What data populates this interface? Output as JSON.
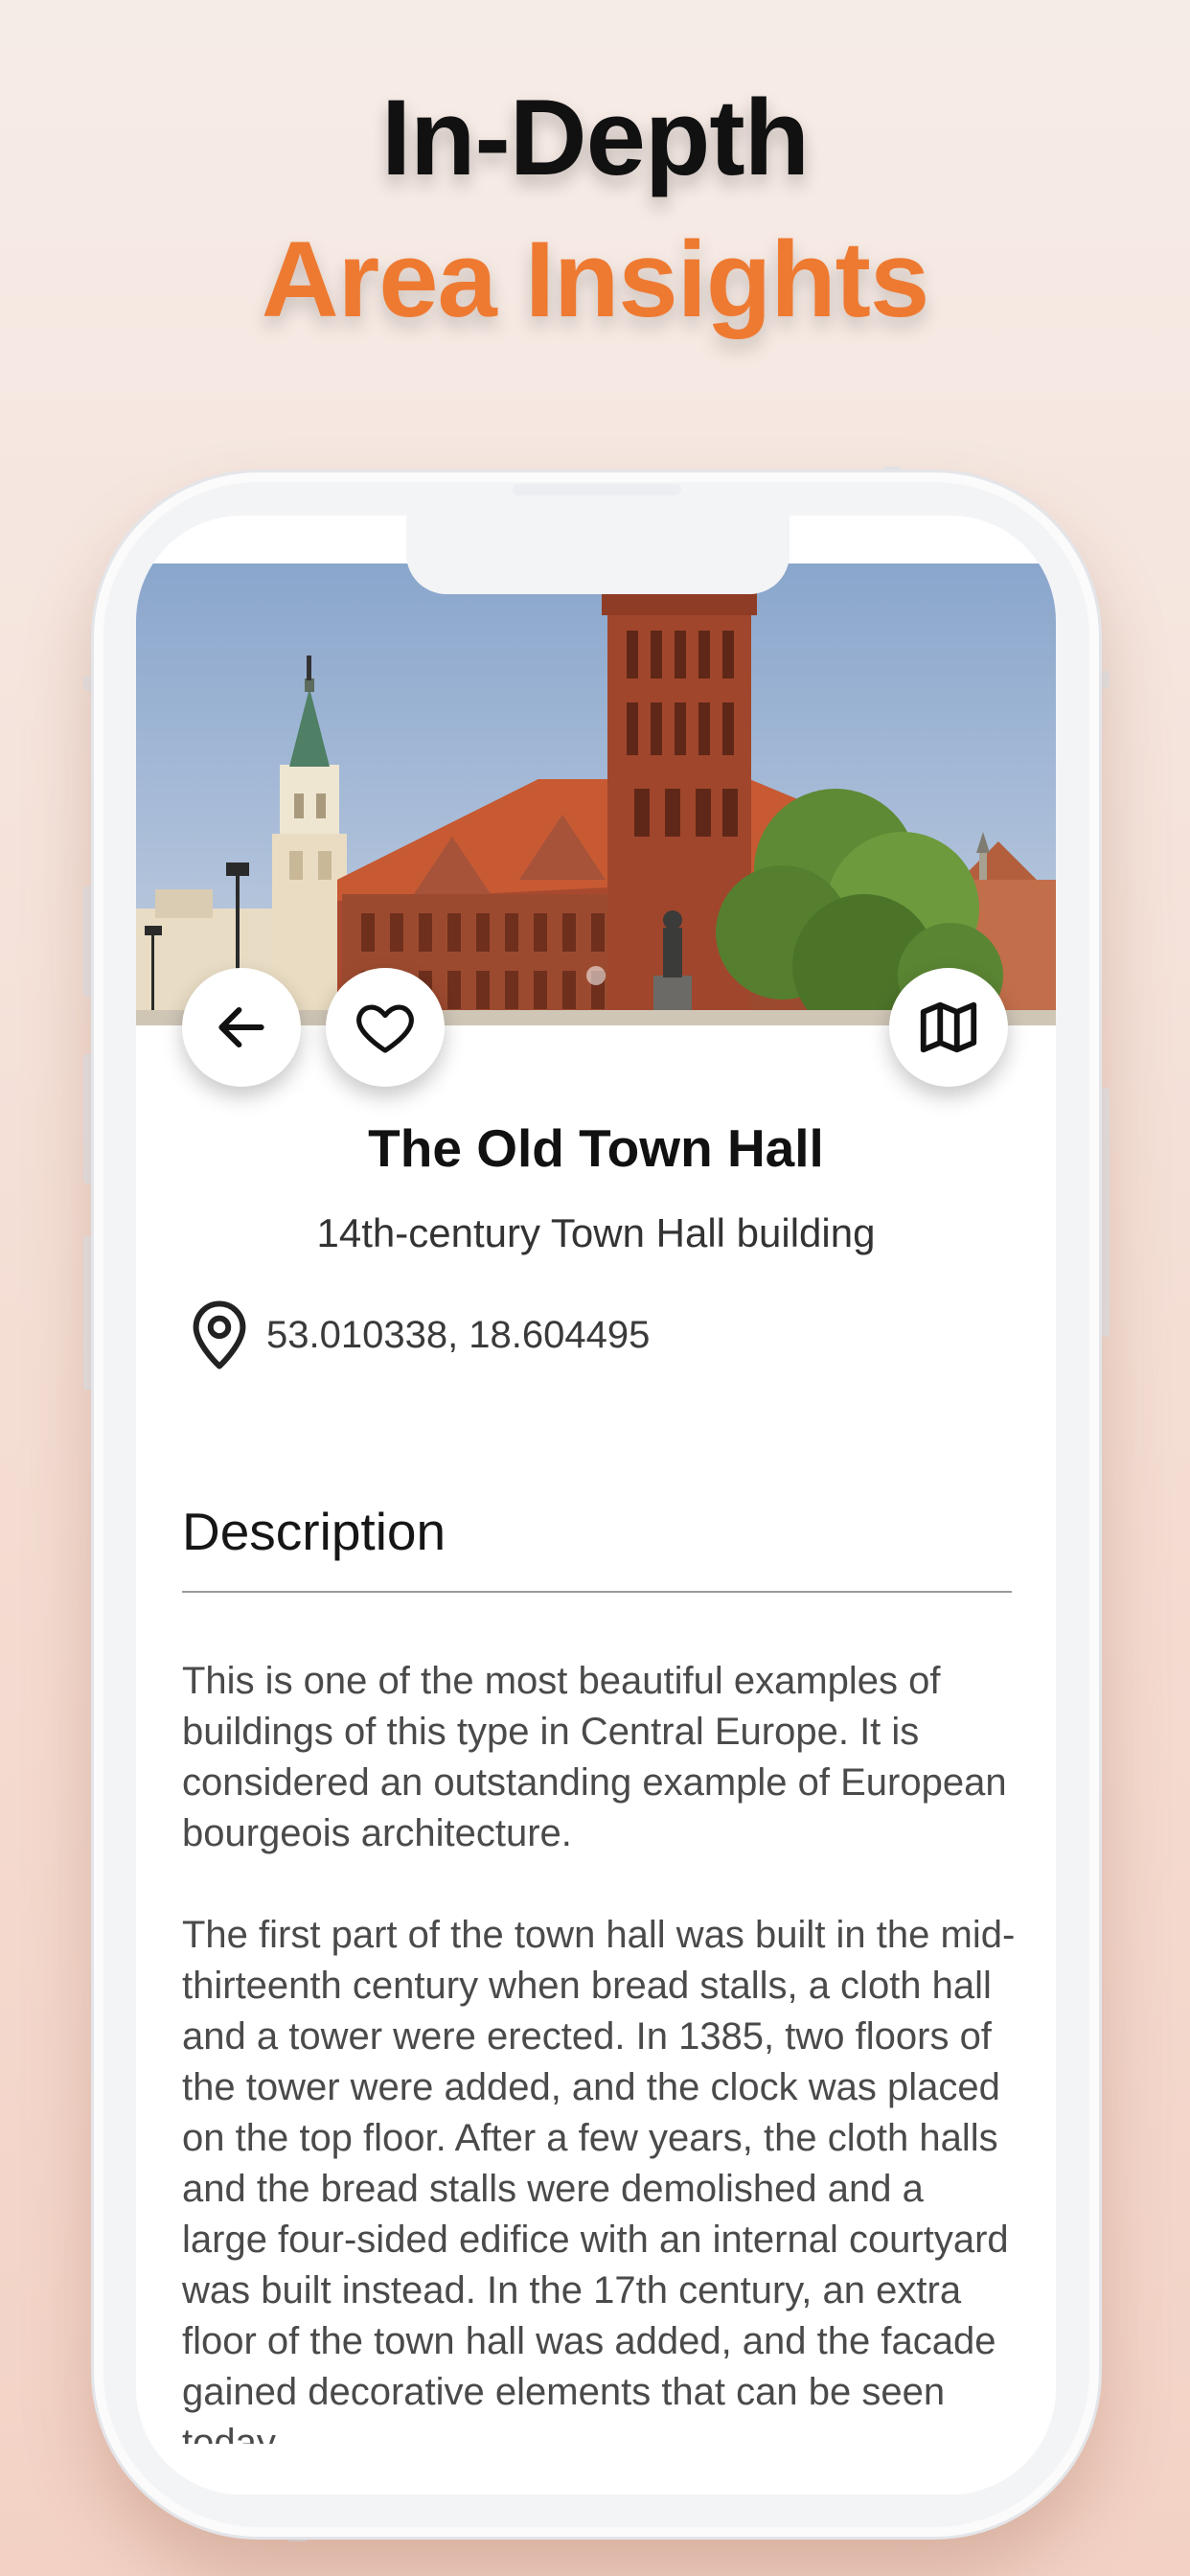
{
  "headline": {
    "line1": "In-Depth",
    "line2": "Area Insights"
  },
  "place": {
    "title": "The Old Town Hall",
    "subtitle": "14th-century Town Hall building",
    "coordinates": "53.010338, 18.604495"
  },
  "description": {
    "heading": "Description",
    "paragraphs": [
      "This is one of the most beautiful examples of buildings of this type in Central Europe. It is considered an outstanding example of European bourgeois architecture.",
      "The first part of the town hall was built in the mid-thirteenth century when bread stalls, a cloth hall and a tower were erected. In 1385, two floors of the tower were added, and the clock was placed on the top floor. After a few years, the cloth halls and the bread stalls were demolished and a large four-sided edifice with an internal courtyard was built instead. In the 17th century, an extra floor of the town hall was added, and the facade gained decorative elements that can be seen today."
    ]
  },
  "icons": {
    "back": "arrow-left-icon",
    "favorite": "heart-icon",
    "map": "map-icon",
    "location": "location-pin-icon"
  },
  "colors": {
    "accent": "#ee7a32",
    "headline_dark": "#111111",
    "background_top": "#f6ece7",
    "background_bottom": "#f3d2c5"
  }
}
